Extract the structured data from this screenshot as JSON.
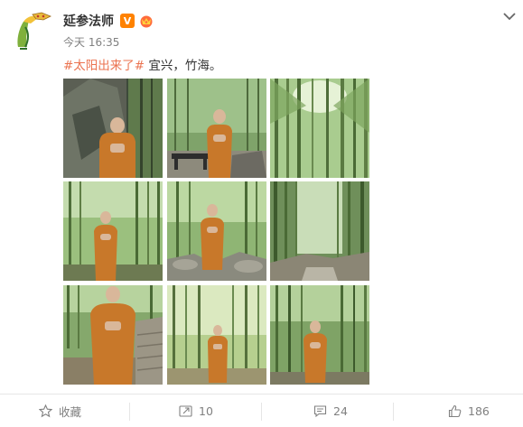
{
  "post": {
    "author": "延参法师",
    "verified_badge": "V",
    "timestamp": "今天 16:35",
    "hashtag": "#太阳出来了#",
    "text": " 宜兴，竹海。"
  },
  "photos": [
    {
      "name": "photo-1",
      "scene": "monk by stone cliff"
    },
    {
      "name": "photo-2",
      "scene": "monk beside stone bench"
    },
    {
      "name": "photo-3",
      "scene": "bamboo canopy"
    },
    {
      "name": "photo-4",
      "scene": "monk in bamboo forest"
    },
    {
      "name": "photo-5",
      "scene": "monk by rocks"
    },
    {
      "name": "photo-6",
      "scene": "misty bamboo path"
    },
    {
      "name": "photo-7",
      "scene": "monk near stone steps"
    },
    {
      "name": "photo-8",
      "scene": "monk in sunny grove"
    },
    {
      "name": "photo-9",
      "scene": "monk on forest path"
    }
  ],
  "actions": {
    "favorite_label": "收藏",
    "repost_count": "10",
    "comment_count": "24",
    "like_count": "186"
  },
  "colors": {
    "hashtag": "#eb7350",
    "badge": "#ff8200",
    "robe": "#c8782a",
    "muted_text": "#808080"
  }
}
